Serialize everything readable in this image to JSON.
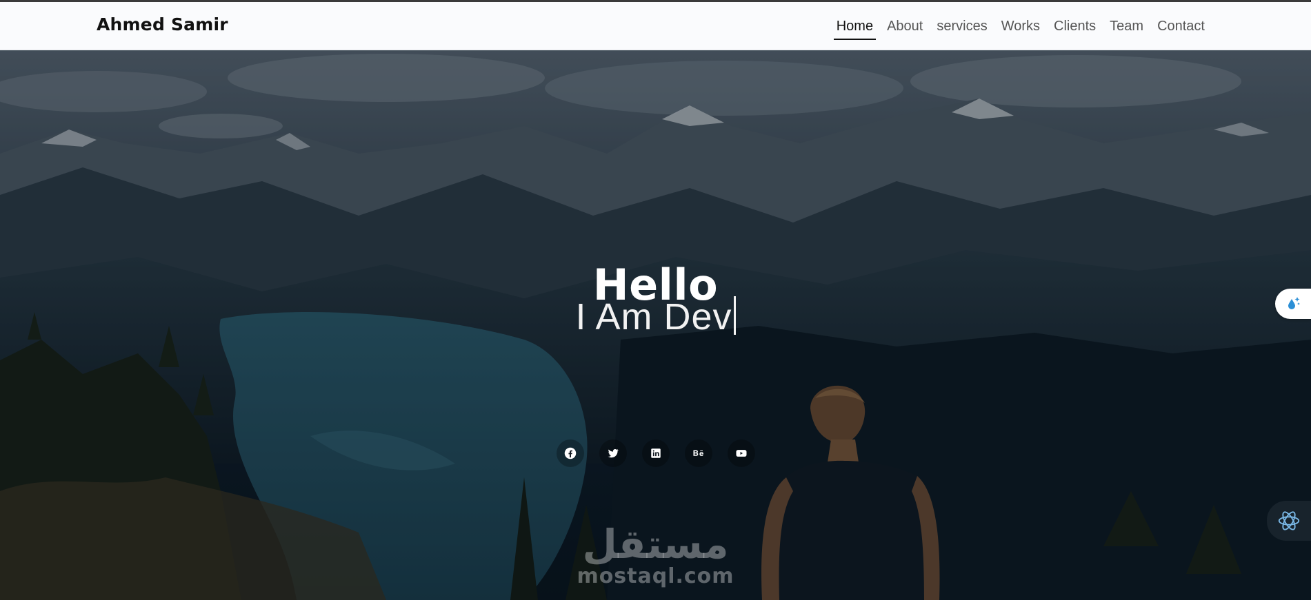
{
  "header": {
    "brand": "Ahmed Samir",
    "nav": [
      {
        "label": "Home",
        "active": true
      },
      {
        "label": "About"
      },
      {
        "label": "services"
      },
      {
        "label": "Works"
      },
      {
        "label": "Clients"
      },
      {
        "label": "Team"
      },
      {
        "label": "Contact"
      }
    ]
  },
  "hero": {
    "title": "Hello",
    "subtitle": "I Am Dev",
    "socials": [
      {
        "name": "facebook-icon"
      },
      {
        "name": "twitter-icon"
      },
      {
        "name": "linkedin-icon"
      },
      {
        "name": "behance-icon"
      },
      {
        "name": "youtube-icon"
      }
    ]
  },
  "watermark": {
    "arabic": "مستقل",
    "latin": "mostaql.com"
  },
  "colors": {
    "nav_bg": "#fafbfd",
    "nav_active": "#111111",
    "nav_text": "#555555",
    "hero_text": "#ffffff",
    "widget_accent": "#2b8fd6"
  }
}
